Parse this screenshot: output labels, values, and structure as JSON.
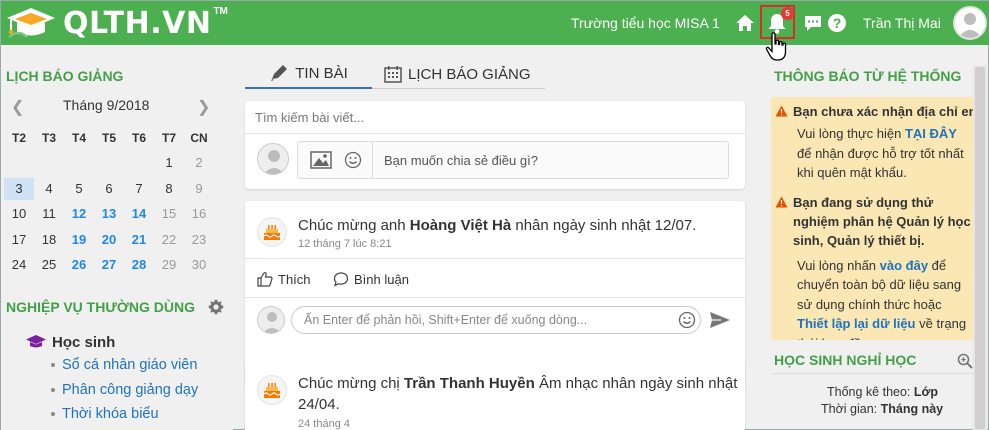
{
  "header": {
    "logo_text": "QLTH.VN",
    "logo_tm": "TM",
    "school": "Trường tiểu học MISA 1",
    "notification_count": "5",
    "user_name": "Trần Thị Mai"
  },
  "left": {
    "calendar_title": "LỊCH BÁO GIẢNG",
    "month_label": "Tháng 9/2018",
    "weekdays": [
      "T2",
      "T3",
      "T4",
      "T5",
      "T6",
      "T7",
      "CN"
    ],
    "weeks": [
      [
        "",
        "",
        "",
        "",
        "",
        "1",
        "2"
      ],
      [
        "3",
        "4",
        "5",
        "6",
        "7",
        "8",
        "9"
      ],
      [
        "10",
        "11",
        "12",
        "13",
        "14",
        "15",
        "16"
      ],
      [
        "17",
        "18",
        "19",
        "20",
        "21",
        "22",
        "23"
      ],
      [
        "24",
        "25",
        "26",
        "27",
        "28",
        "29",
        "30"
      ]
    ],
    "highlighted_days": [
      "12",
      "13",
      "14",
      "19",
      "20",
      "21",
      "26",
      "27",
      "28"
    ],
    "dimmed_days": [
      "2",
      "9",
      "15",
      "16",
      "22",
      "23",
      "29",
      "30"
    ],
    "today": "3",
    "tasks_title": "NGHIỆP VỤ THƯỜNG DÙNG",
    "group_label": "Học sinh",
    "items": [
      "Sổ cá nhân giáo viên",
      "Phân công giảng dạy",
      "Thời khóa biểu"
    ]
  },
  "center": {
    "tabs": [
      "TIN BÀI",
      "LỊCH BÁO GIẢNG"
    ],
    "search_placeholder": "Tìm kiếm bài viết...",
    "compose_placeholder": "Bạn muốn chia sẻ điều gì?",
    "posts": [
      {
        "prefix": "Chúc mừng anh ",
        "name": "Hoàng Việt Hà",
        "suffix": " nhân ngày sinh nhật 12/07.",
        "time": "12 tháng 7 lúc 8:21",
        "like": "Thích",
        "comment": "Bình luận",
        "reply_placeholder": "Ấn Enter để phản hồi, Shift+Enter để xuống dòng..."
      },
      {
        "prefix": "Chúc mừng chị ",
        "name": "Trần Thanh Huyền",
        "suffix": " Âm nhạc nhân ngày sinh nhật 24/04.",
        "time": "24 tháng 4"
      }
    ]
  },
  "right": {
    "notice_title": "THÔNG BÁO TỪ HỆ THỐNG",
    "notice1_head": "Bạn chưa xác nhận địa chỉ email",
    "notice1_a": "Vui lòng thực hiện ",
    "notice1_link": "TẠI ĐÂY",
    "notice1_b": " để nhận được hỗ trợ tốt nhất khi quên mật khẩu.",
    "notice2_head": "Bạn đang sử dụng thử nghiệm phân hệ Quản lý học sinh, Quản lý thiết bị.",
    "notice2_a": "Vui lòng nhấn ",
    "notice2_link1": "vào đây",
    "notice2_b": " để chuyển toàn bộ dữ liệu sang sử dụng chính thức hoặc ",
    "notice2_link2": "Thiết lập lại dữ liệu",
    "notice2_c": " về trạng thái ban đầu.",
    "absent_title": "HỌC SINH NGHỈ HỌC",
    "stat_by_label": "Thống kê theo: ",
    "stat_by_value": "Lớp",
    "time_label": "Thời gian: ",
    "time_value": "Tháng này"
  },
  "colors": {
    "header_green": "#4caf50",
    "section_green": "#43a047",
    "link_blue": "#1e73be",
    "notice_bg": "#fbe7b3",
    "badge_red": "#e53935"
  }
}
